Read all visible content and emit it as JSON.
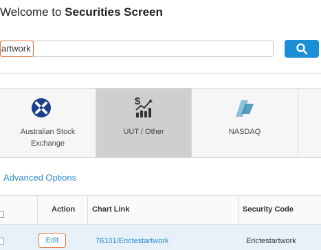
{
  "header": {
    "title_prefix": "Welcome to ",
    "title_bold": "Securities Screen"
  },
  "search": {
    "value": "artwork",
    "button_icon": "search-icon"
  },
  "exchanges": [
    {
      "line1": "Australian Stock",
      "line2": "Exchange",
      "icon": "asx-logo-icon",
      "selected": false
    },
    {
      "line1": "UUT / Other",
      "icon": "money-chart-icon",
      "selected": true
    },
    {
      "line1": "NASDAQ",
      "icon": "nasdaq-logo-icon",
      "selected": false
    }
  ],
  "advanced_options": "Advanced Options",
  "table": {
    "headers": {
      "action": "Action",
      "chart_link": "Chart Link",
      "security_code": "Security Code"
    },
    "rows": [
      {
        "action": "Edit",
        "chart_link": "76101/Erictestartwork",
        "security_code": "Erictestartwork"
      }
    ]
  },
  "colors": {
    "accent": "#1a8fd6",
    "highlight": "#e0703a",
    "link": "#2a8ad0",
    "row_bg": "#e6f1fa"
  }
}
